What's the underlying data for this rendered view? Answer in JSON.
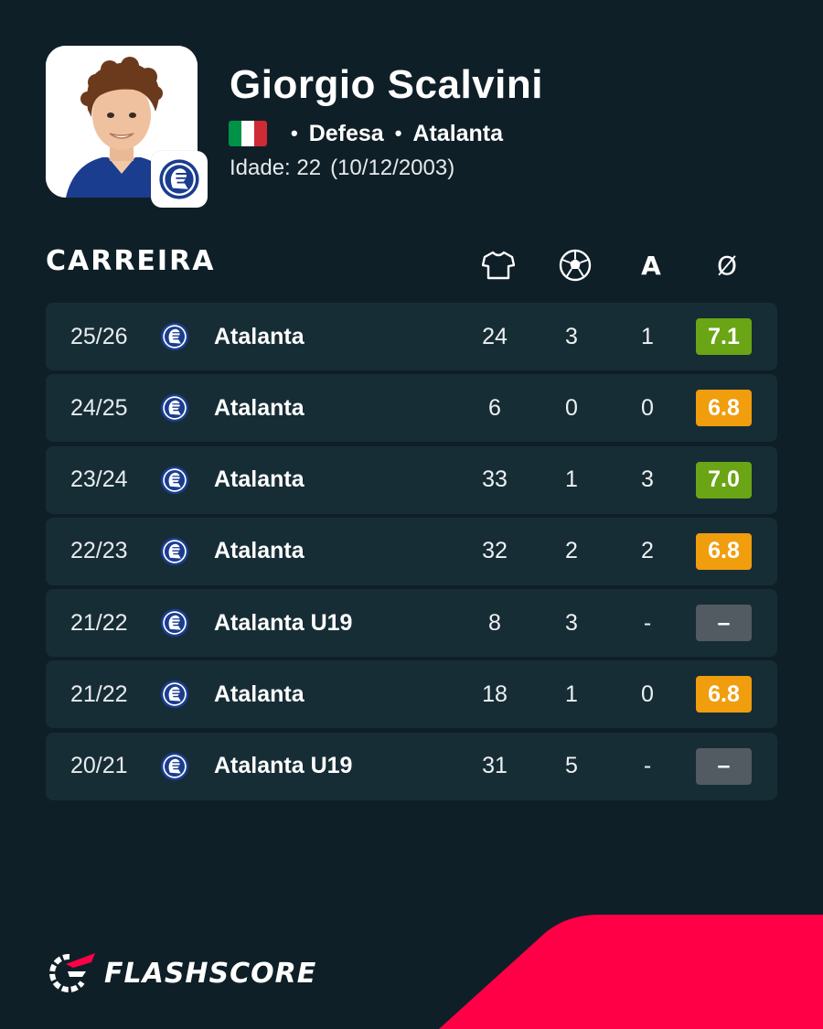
{
  "player": {
    "name": "Giorgio Scalvini",
    "position": "Defesa",
    "club": "Atalanta",
    "age_label": "Idade: 22",
    "birth_date": "(10/12/2003)",
    "flag_colors": [
      "#009246",
      "#ffffff",
      "#ce2b37"
    ]
  },
  "career": {
    "title": "CARREIRA",
    "column_icons": [
      "shirt-icon",
      "ball-icon"
    ],
    "col_assists": "A",
    "col_average": "Ø",
    "rows": [
      {
        "season": "25/26",
        "team": "Atalanta",
        "apps": "24",
        "goals": "3",
        "assists": "1",
        "rating": "7.1",
        "rating_color": "#6aa515"
      },
      {
        "season": "24/25",
        "team": "Atalanta",
        "apps": "6",
        "goals": "0",
        "assists": "0",
        "rating": "6.8",
        "rating_color": "#f09d0e"
      },
      {
        "season": "23/24",
        "team": "Atalanta",
        "apps": "33",
        "goals": "1",
        "assists": "3",
        "rating": "7.0",
        "rating_color": "#6aa515"
      },
      {
        "season": "22/23",
        "team": "Atalanta",
        "apps": "32",
        "goals": "2",
        "assists": "2",
        "rating": "6.8",
        "rating_color": "#f09d0e"
      },
      {
        "season": "21/22",
        "team": "Atalanta U19",
        "apps": "8",
        "goals": "3",
        "assists": "-",
        "rating": "–",
        "rating_color": "#515b61"
      },
      {
        "season": "21/22",
        "team": "Atalanta",
        "apps": "18",
        "goals": "1",
        "assists": "0",
        "rating": "6.8",
        "rating_color": "#f09d0e"
      },
      {
        "season": "20/21",
        "team": "Atalanta U19",
        "apps": "31",
        "goals": "5",
        "assists": "-",
        "rating": "–",
        "rating_color": "#515b61"
      }
    ]
  },
  "brand": {
    "name": "FLASHSCORE",
    "accent_color": "#ff0046",
    "background_color": "#0f1f27"
  }
}
